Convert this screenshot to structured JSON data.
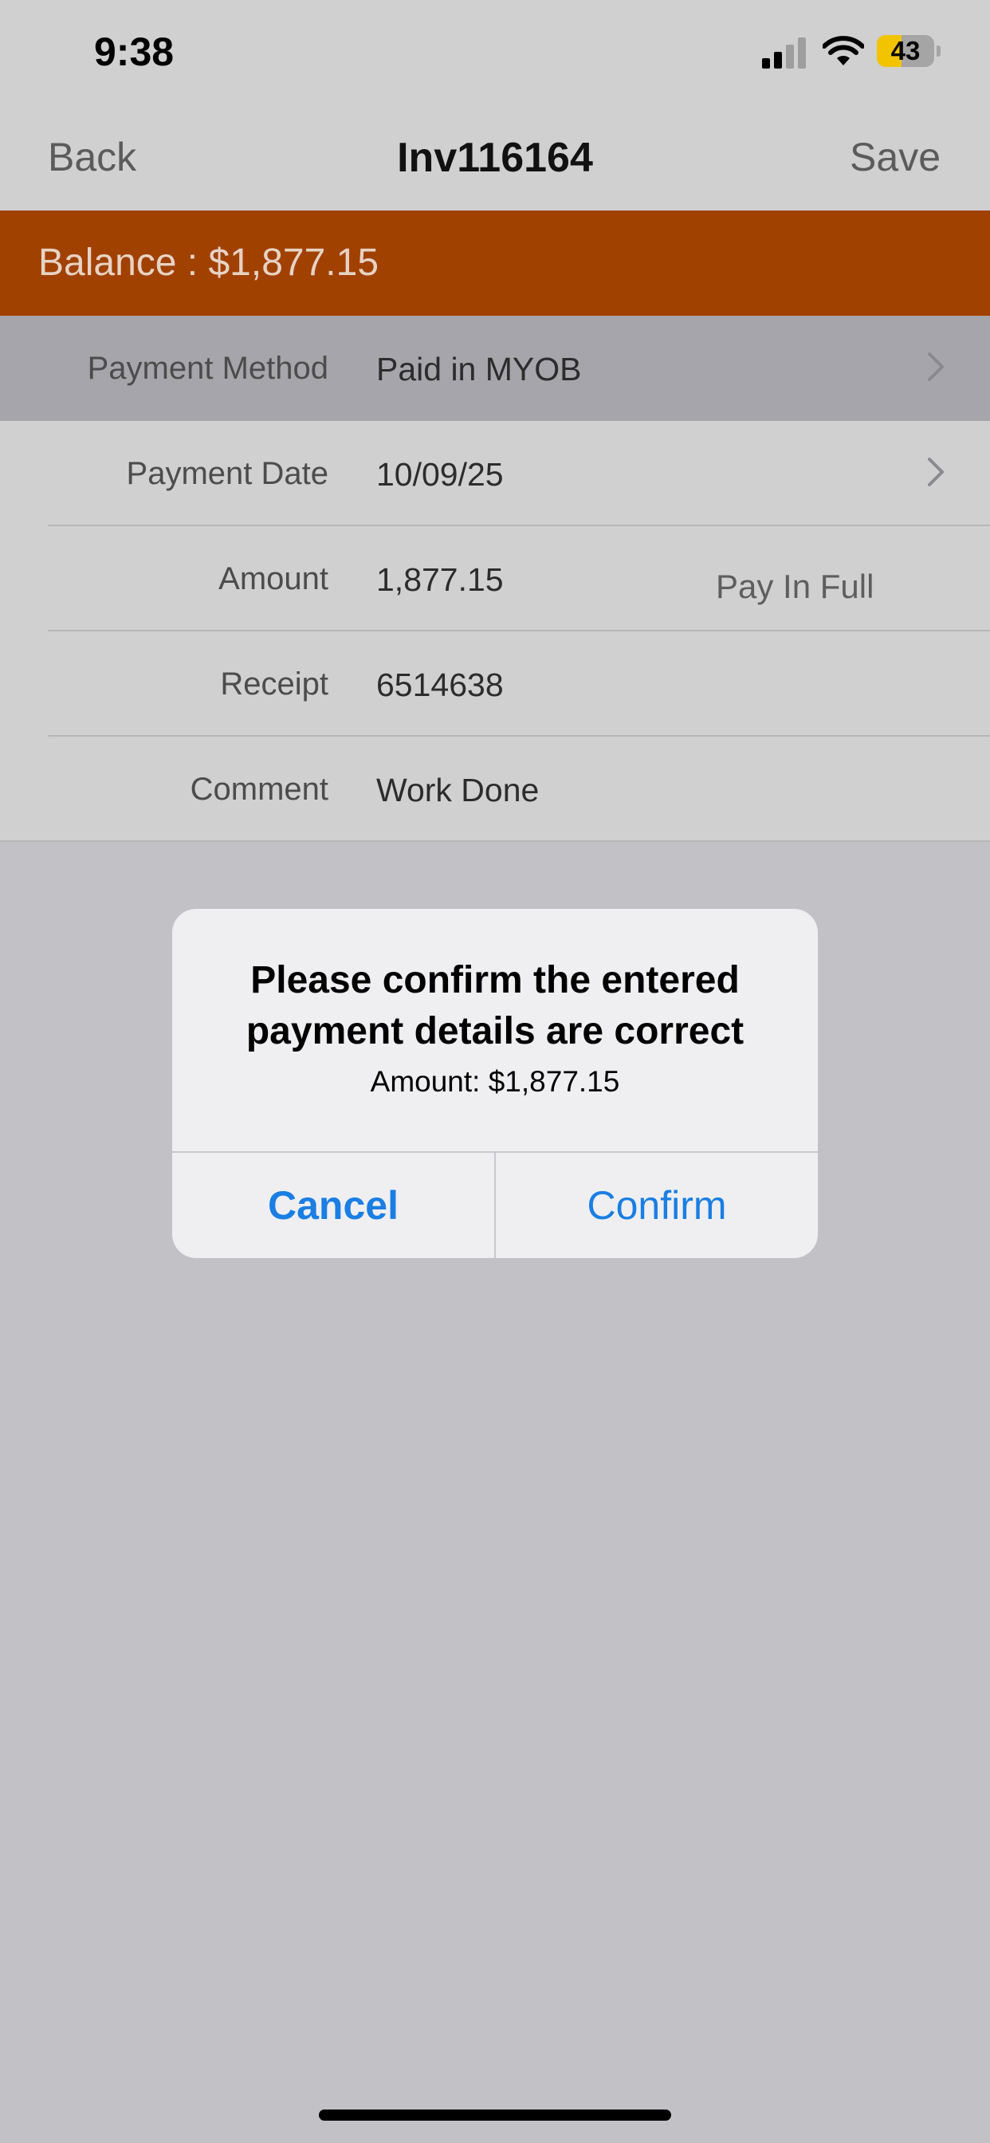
{
  "status_bar": {
    "time": "9:38",
    "battery_level": "43",
    "battery_fraction": 0.43,
    "icons": [
      "signal-icon",
      "wifi-icon",
      "battery-icon"
    ]
  },
  "nav": {
    "back_label": "Back",
    "title": "Inv116164",
    "save_label": "Save"
  },
  "balance": {
    "text": "Balance : $1,877.15"
  },
  "form": {
    "payment_method": {
      "label": "Payment Method",
      "value": "Paid in MYOB"
    },
    "payment_date": {
      "label": "Payment Date",
      "value": "10/09/25"
    },
    "amount": {
      "label": "Amount",
      "value": "1,877.15",
      "action": "Pay In Full"
    },
    "receipt": {
      "label": "Receipt",
      "value": "6514638"
    },
    "comment": {
      "label": "Comment",
      "value": "Work Done"
    }
  },
  "alert": {
    "title": "Please confirm the entered payment details are correct",
    "message": "Amount: $1,877.15",
    "cancel_label": "Cancel",
    "confirm_label": "Confirm"
  },
  "colors": {
    "balance_banner": "#a14100",
    "alert_button": "#1a7ee3",
    "battery_fill": "#f2c400"
  }
}
